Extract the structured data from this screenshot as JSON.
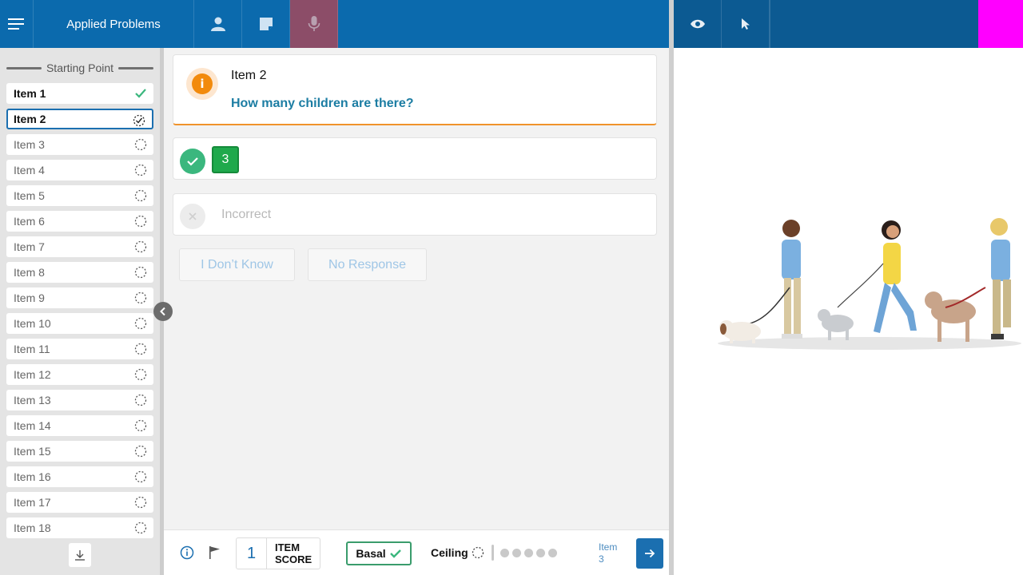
{
  "toolbar": {
    "title": "Applied Problems"
  },
  "sidebar": {
    "header": "Starting Point",
    "items": [
      {
        "label": "Item 1",
        "status": "correct"
      },
      {
        "label": "Item 2",
        "status": "in-progress"
      },
      {
        "label": "Item 3",
        "status": "pending"
      },
      {
        "label": "Item 4",
        "status": "pending"
      },
      {
        "label": "Item 5",
        "status": "pending"
      },
      {
        "label": "Item 6",
        "status": "pending"
      },
      {
        "label": "Item 7",
        "status": "pending"
      },
      {
        "label": "Item 8",
        "status": "pending"
      },
      {
        "label": "Item 9",
        "status": "pending"
      },
      {
        "label": "Item 10",
        "status": "pending"
      },
      {
        "label": "Item 11",
        "status": "pending"
      },
      {
        "label": "Item 12",
        "status": "pending"
      },
      {
        "label": "Item 13",
        "status": "pending"
      },
      {
        "label": "Item 14",
        "status": "pending"
      },
      {
        "label": "Item 15",
        "status": "pending"
      },
      {
        "label": "Item 16",
        "status": "pending"
      },
      {
        "label": "Item 17",
        "status": "pending"
      },
      {
        "label": "Item 18",
        "status": "pending"
      }
    ]
  },
  "question": {
    "item_title": "Item 2",
    "prompt": "How many children are there?"
  },
  "answer": {
    "correct_value": "3",
    "incorrect_label": "Incorrect"
  },
  "buttons": {
    "dont_know": "I Don’t Know",
    "no_response": "No Response"
  },
  "bottom": {
    "item_score_value": "1",
    "item_score_line1": "ITEM",
    "item_score_line2": "SCORE",
    "basal_label": "Basal",
    "ceiling_label": "Ceiling",
    "ceiling_progress_dots": 5,
    "next_item_line1": "Item",
    "next_item_line2": "3"
  },
  "colors": {
    "primary": "#0b6aad",
    "active_tab": "#8c4d68",
    "accent_orange": "#f28a0c",
    "correct_green": "#1fa94c",
    "question_text": "#1c7da3",
    "magenta": "#ff00ff"
  }
}
